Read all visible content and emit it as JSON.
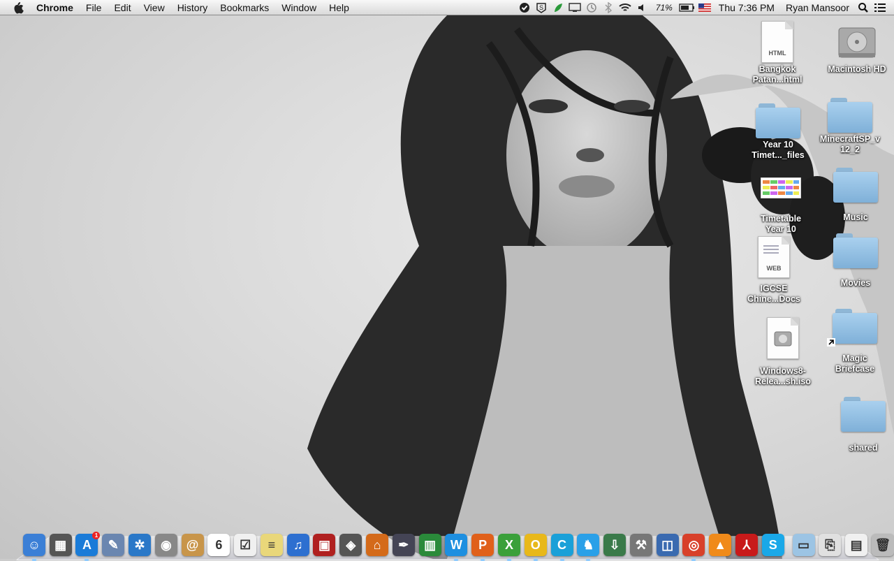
{
  "menubar": {
    "app": "Chrome",
    "menus": [
      "File",
      "Edit",
      "View",
      "History",
      "Bookmarks",
      "Window",
      "Help"
    ],
    "battery": "71%",
    "clock": "Thu 7:36 PM",
    "user": "Ryan Mansoor",
    "status_icons": [
      "shield-check-icon",
      "s-tray-icon",
      "leaf-icon",
      "display-icon",
      "time-machine-icon",
      "bluetooth-icon",
      "wifi-icon",
      "volume-icon",
      "battery-icon",
      "flag-icon",
      "spotlight-icon",
      "list-icon"
    ]
  },
  "desktop": {
    "icons": [
      {
        "label1": "Bangkok",
        "label2": "Patan...html",
        "kind": "html-document",
        "tag": "HTML"
      },
      {
        "label1": "Macintosh HD",
        "label2": "",
        "kind": "hard-drive"
      },
      {
        "label1": "Year 10",
        "label2": "Timet..._files",
        "kind": "folder"
      },
      {
        "label1": "MinecraftSP_v",
        "label2": "12_2",
        "kind": "folder"
      },
      {
        "label1": "Timetable",
        "label2": "Year 10",
        "kind": "spreadsheet-thumbnail"
      },
      {
        "label1": "Music",
        "label2": "",
        "kind": "folder"
      },
      {
        "label1": "IGCSE",
        "label2": "Chine...Docs",
        "kind": "web-document",
        "tag": "WEB"
      },
      {
        "label1": "Movies",
        "label2": "",
        "kind": "folder"
      },
      {
        "label1": "Windows8-",
        "label2": "Relea...sh.iso",
        "kind": "disk-image"
      },
      {
        "label1": "Magic",
        "label2": "Briefcase",
        "kind": "folder-alias"
      },
      {
        "label1": "shared",
        "label2": "",
        "kind": "folder"
      }
    ]
  },
  "dock": {
    "apps": [
      {
        "name": "finder-icon",
        "color": "#3b7fd6",
        "glyph": "☺",
        "running": true
      },
      {
        "name": "photo-booth-icon",
        "color": "#555",
        "glyph": "▦",
        "running": false
      },
      {
        "name": "app-store-icon",
        "color": "#1a7bd8",
        "glyph": "A",
        "running": true,
        "badge": "1"
      },
      {
        "name": "preview-icon",
        "color": "#6a86b0",
        "glyph": "✎",
        "running": false
      },
      {
        "name": "safari-icon",
        "color": "#2a78c8",
        "glyph": "✲",
        "running": false
      },
      {
        "name": "facetime-icon",
        "color": "#888",
        "glyph": "◉",
        "running": false
      },
      {
        "name": "contacts-icon",
        "color": "#c8954a",
        "glyph": "@",
        "running": false
      },
      {
        "name": "calendar-icon",
        "color": "#ffffff",
        "glyph": "6",
        "running": false
      },
      {
        "name": "reminders-icon",
        "color": "#f0f0f0",
        "glyph": "☑",
        "running": false
      },
      {
        "name": "notes-icon",
        "color": "#e9d77a",
        "glyph": "≡",
        "running": false
      },
      {
        "name": "itunes-icon",
        "color": "#2d6fd0",
        "glyph": "♫",
        "running": false
      },
      {
        "name": "photo-slideshow-icon",
        "color": "#b02020",
        "glyph": "▣",
        "running": false
      },
      {
        "name": "iphoto-icon",
        "color": "#555",
        "glyph": "◈",
        "running": false
      },
      {
        "name": "keynote-icon",
        "color": "#d46a1a",
        "glyph": "⌂",
        "running": false
      },
      {
        "name": "pages-icon",
        "color": "#445",
        "glyph": "✒",
        "running": false
      },
      {
        "name": "numbers-icon",
        "color": "#2a8a3a",
        "glyph": "▥",
        "running": false
      },
      {
        "name": "word-icon",
        "color": "#1e8fe0",
        "glyph": "W",
        "running": true
      },
      {
        "name": "powerpoint-icon",
        "color": "#e0601a",
        "glyph": "P",
        "running": true
      },
      {
        "name": "excel-icon",
        "color": "#3aa03a",
        "glyph": "X",
        "running": true
      },
      {
        "name": "outlook-icon",
        "color": "#e8b81a",
        "glyph": "O",
        "running": true
      },
      {
        "name": "lync-icon",
        "color": "#1aa0d8",
        "glyph": "C",
        "running": true
      },
      {
        "name": "messenger-icon",
        "color": "#2aa0e8",
        "glyph": "♞",
        "running": true
      },
      {
        "name": "installer-icon",
        "color": "#3a7a4a",
        "glyph": "⇩",
        "running": false
      },
      {
        "name": "boot-camp-icon",
        "color": "#777",
        "glyph": "⚒",
        "running": false
      },
      {
        "name": "virtualbox-icon",
        "color": "#3a6ab0",
        "glyph": "◫",
        "running": false
      },
      {
        "name": "chrome-icon",
        "color": "#d8402a",
        "glyph": "◎",
        "running": true
      },
      {
        "name": "vlc-icon",
        "color": "#f08a1a",
        "glyph": "▲",
        "running": false
      },
      {
        "name": "adobe-reader-icon",
        "color": "#c81a1a",
        "glyph": "⅄",
        "running": false
      },
      {
        "name": "skype-icon",
        "color": "#1aa8e8",
        "glyph": "S",
        "running": false
      }
    ],
    "stacks": [
      {
        "name": "applications-folder-icon",
        "color": "#9cc4e4",
        "glyph": "▭"
      },
      {
        "name": "archive-stack-icon",
        "color": "#e0e0e0",
        "glyph": "⎘"
      },
      {
        "name": "documents-stack-icon",
        "color": "#f0f0f0",
        "glyph": "▤"
      },
      {
        "name": "trash-icon",
        "color": "#bbb",
        "glyph": "🗑"
      }
    ]
  }
}
